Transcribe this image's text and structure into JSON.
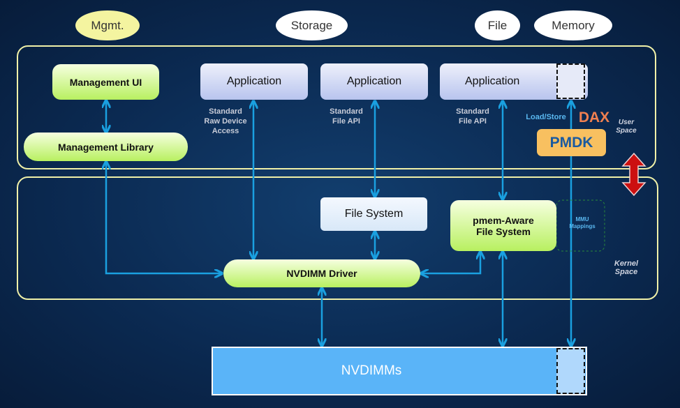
{
  "categories": {
    "mgmt": "Mgmt.",
    "storage": "Storage",
    "file": "File",
    "memory": "Memory"
  },
  "user_space": {
    "label_line1": "User",
    "label_line2": "Space"
  },
  "kernel_space": {
    "label_line1": "Kernel",
    "label_line2": "Space"
  },
  "management_ui": "Management UI",
  "management_library": "Management Library",
  "applications": [
    "Application",
    "Application",
    "Application"
  ],
  "api_labels": {
    "raw": [
      "Standard",
      "Raw Device",
      "Access"
    ],
    "file1": [
      "Standard",
      "File API"
    ],
    "file2": [
      "Standard",
      "File API"
    ]
  },
  "load_store": "Load/Store",
  "dax": "DAX",
  "pmdk": "PMDK",
  "file_system": "File System",
  "pmem_fs": [
    "pmem-Aware",
    "File System"
  ],
  "mmu": [
    "MMU",
    "Mappings"
  ],
  "nvdimm_driver": "NVDIMM Driver",
  "nvdimms": "NVDIMMs",
  "colors": {
    "arrow": "#1aa0e0",
    "border": "#f0f0a8",
    "pmdk": "#f8c060",
    "dax": "#f08050",
    "nvdimm": "#5ab4f8",
    "transition_arrow": "#cc1010"
  }
}
